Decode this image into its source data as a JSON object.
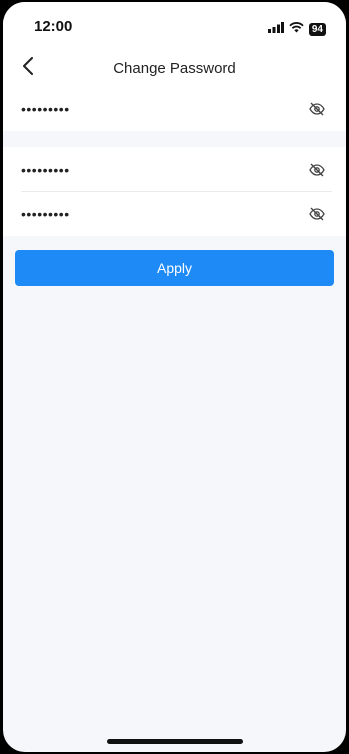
{
  "status_bar": {
    "time": "12:00",
    "battery": "94",
    "icons": [
      "signal-icon",
      "wifi-icon",
      "battery-icon"
    ]
  },
  "header": {
    "back_icon": "chevron-left-icon",
    "title": "Change Password"
  },
  "fields": [
    {
      "value": "•••••••••",
      "icon": "eye-off-icon"
    },
    {
      "value": "•••••••••",
      "icon": "eye-off-icon"
    },
    {
      "value": "•••••••••",
      "icon": "eye-off-icon"
    }
  ],
  "apply_label": "Apply",
  "colors": {
    "accent": "#1e8af5",
    "background": "#f5f7fa",
    "surface": "#ffffff"
  }
}
